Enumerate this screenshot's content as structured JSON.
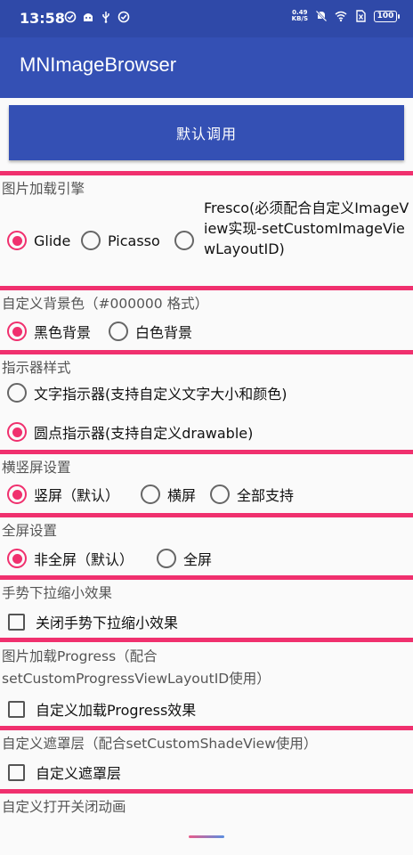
{
  "status_bar": {
    "time": "13:58",
    "net_speed_value": "0.49",
    "net_speed_unit": "KB/S",
    "battery": "100"
  },
  "app_bar": {
    "title": "MNImageBrowser"
  },
  "main_button": {
    "label": "默认调用"
  },
  "sections": {
    "engine": {
      "title": "图片加载引擎",
      "options": [
        "Glide",
        "Picasso",
        "Fresco(必须配合自定义ImageView实现-setCustomImageViewLayoutID)"
      ]
    },
    "background": {
      "title": "自定义背景色（#000000 格式）",
      "options": [
        "黑色背景",
        "白色背景"
      ]
    },
    "indicator": {
      "title": "指示器样式",
      "options": [
        "文字指示器(支持自定义文字大小和颜色)",
        "圆点指示器(支持自定义drawable)"
      ]
    },
    "orientation": {
      "title": "横竖屏设置",
      "options": [
        "竖屏（默认）",
        "横屏",
        "全部支持"
      ]
    },
    "fullscreen": {
      "title": "全屏设置",
      "options": [
        "非全屏（默认）",
        "全屏"
      ]
    },
    "gesture": {
      "title": "手势下拉缩小效果",
      "checkbox": "关闭手势下拉缩小效果"
    },
    "progress": {
      "title_line1": "图片加载Progress（配合",
      "title_line2": "setCustomProgressViewLayoutID使用）",
      "checkbox": "自定义加载Progress效果"
    },
    "shade": {
      "title": "自定义遮罩层（配合setCustomShadeView使用）",
      "checkbox": "自定义遮罩层"
    },
    "animation": {
      "title": "自定义打开关闭动画"
    }
  },
  "colors": {
    "primary": "#3450b4",
    "status_bar": "#2f49a8",
    "accent": "#f0306e"
  }
}
